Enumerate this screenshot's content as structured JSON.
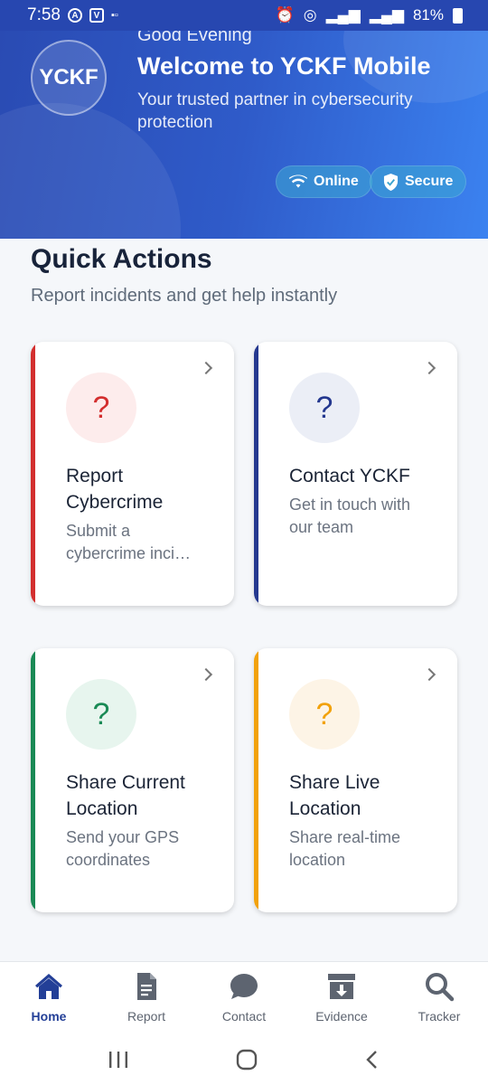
{
  "status_bar": {
    "time": "7:58",
    "icons_left": [
      "a-badge-icon",
      "v-badge-icon",
      "carrier-label-icon"
    ],
    "battery": "81%"
  },
  "header": {
    "greeting": "Good Evening",
    "title": "Welcome to YCKF Mobile",
    "tagline": "Your trusted partner in cybersecurity protection",
    "logo_text": "YCKF",
    "badges": [
      {
        "label": "Online",
        "icon": "wifi-icon"
      },
      {
        "label": "Secure",
        "icon": "shield-check-icon"
      }
    ],
    "colors": {
      "gradient_start": "#2a4bb3",
      "gradient_end": "#3b82f0"
    }
  },
  "quick_actions": {
    "title": "Quick Actions",
    "subtitle": "Report incidents and get help instantly",
    "cards": [
      {
        "icon_glyph": "?",
        "title": "Report Cybercrime",
        "description": "Submit a cybercrime inci…",
        "accent": "#d32f2f",
        "icon_bg": "#fdecec"
      },
      {
        "icon_glyph": "?",
        "title": "Contact YCKF",
        "description": "Get in touch with our team",
        "accent": "#24388f",
        "icon_bg": "#ebeef6"
      },
      {
        "icon_glyph": "?",
        "title": "Share Current Location",
        "description": "Send your GPS coordinates",
        "accent": "#1a8a55",
        "icon_bg": "#e7f5ee"
      },
      {
        "icon_glyph": "?",
        "title": "Share Live Location",
        "description": "Share real-time location",
        "accent": "#f2a20c",
        "icon_bg": "#fdf4e6"
      }
    ]
  },
  "bottom_nav": {
    "items": [
      {
        "label": "Home",
        "icon": "home-icon",
        "active": true
      },
      {
        "label": "Report",
        "icon": "document-icon",
        "active": false
      },
      {
        "label": "Contact",
        "icon": "chat-bubble-icon",
        "active": false
      },
      {
        "label": "Evidence",
        "icon": "archive-download-icon",
        "active": false
      },
      {
        "label": "Tracker",
        "icon": "search-icon",
        "active": false
      }
    ]
  },
  "system_nav": [
    "recents-icon",
    "home-circle-icon",
    "back-icon"
  ]
}
